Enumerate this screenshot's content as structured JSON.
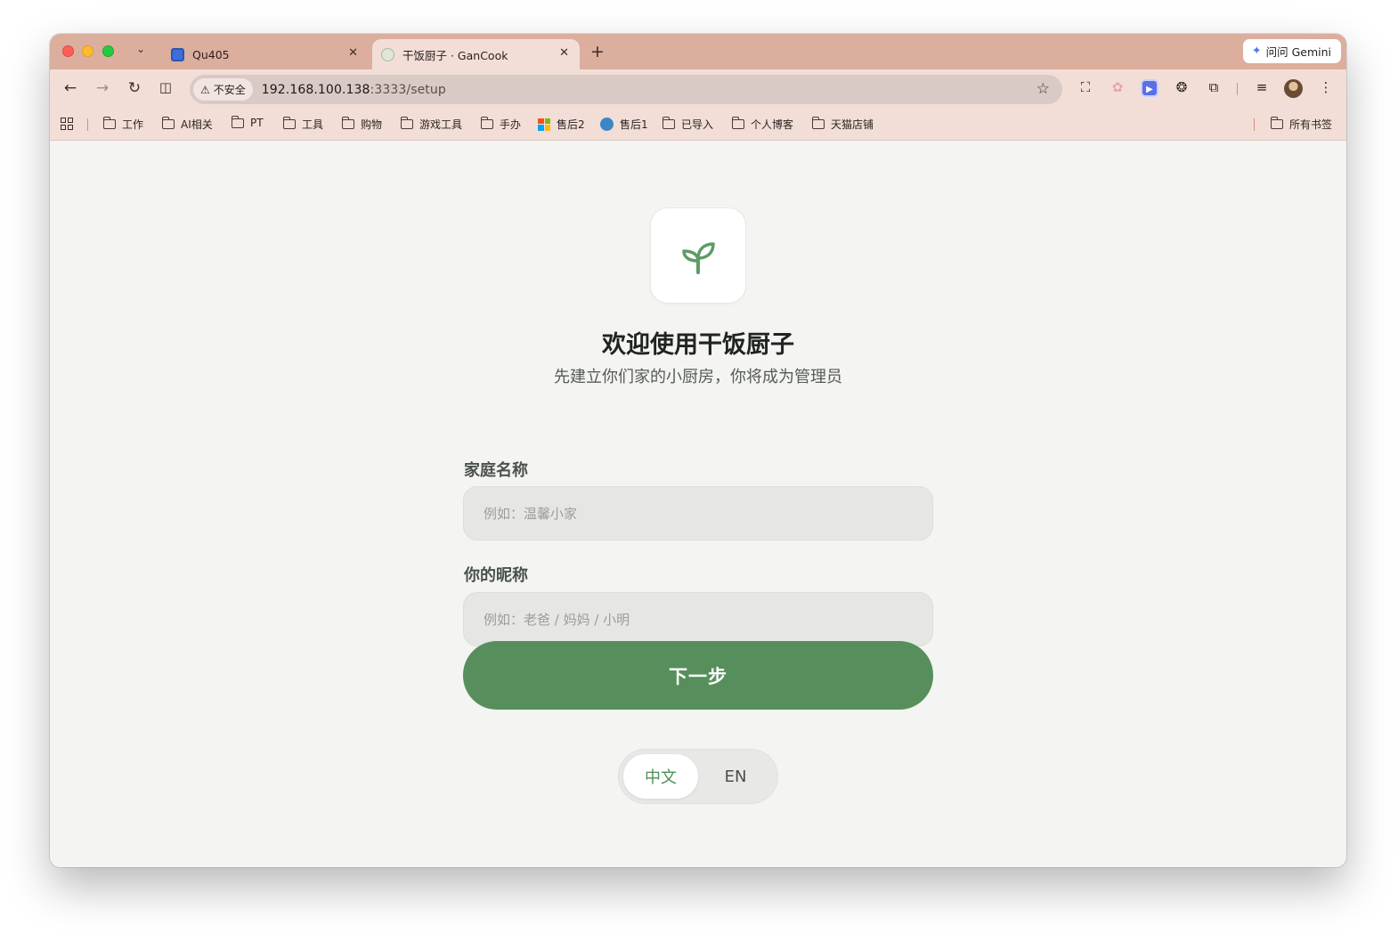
{
  "browser": {
    "tabs": [
      {
        "title": "Qu405",
        "active": false
      },
      {
        "title": "干饭厨子 · GanCook",
        "active": true
      }
    ],
    "gemini_button": "问问 Gemini",
    "security_chip": "不安全",
    "url_host": "192.168.100.138",
    "url_path": ":3333/setup",
    "bookmarks": [
      "工作",
      "AI相关",
      "PT",
      "工具",
      "购物",
      "游戏工具",
      "手办",
      "售后2",
      "售后1",
      "已导入",
      "个人博客",
      "天猫店铺"
    ],
    "all_bookmarks": "所有书签"
  },
  "page": {
    "title": "欢迎使用干饭厨子",
    "subtitle": "先建立你们家的小厨房，你将成为管理员",
    "family_label": "家庭名称",
    "family_placeholder": "例如：温馨小家",
    "nickname_label": "你的昵称",
    "nickname_placeholder": "例如：老爸 / 妈妈 / 小明",
    "next_button": "下一步",
    "lang_zh": "中文",
    "lang_en": "EN",
    "selected_lang": "中文"
  },
  "colors": {
    "accent": "#578f5c",
    "tab_strip": "#dcae9e",
    "toolbar": "#f2ded7",
    "page_bg": "#f4f4f2"
  },
  "icons": [
    "sprout-icon",
    "back-icon",
    "forward-icon",
    "reload-icon",
    "split-view-icon",
    "warning-icon",
    "star-icon",
    "extensions-icon",
    "menu-icon",
    "folder-icon",
    "apps-grid-icon"
  ]
}
